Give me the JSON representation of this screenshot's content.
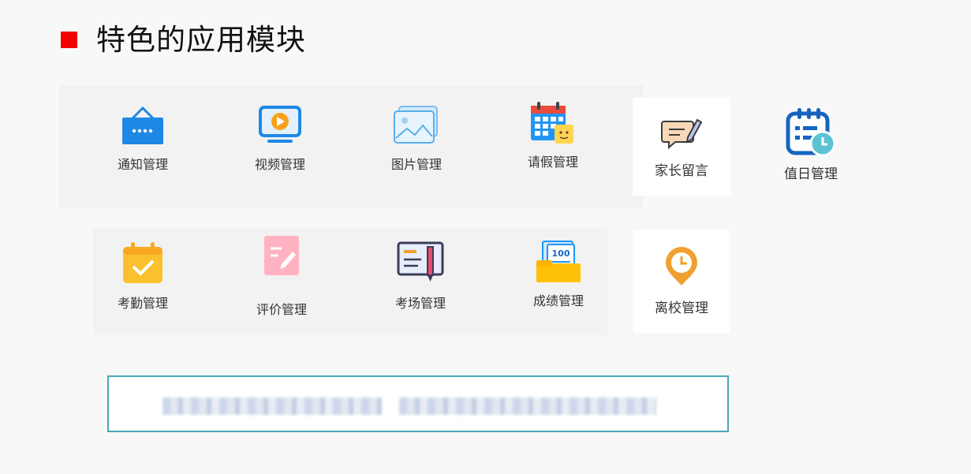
{
  "header": {
    "title": "特色的应用模块"
  },
  "modules_row1": [
    {
      "label": "通知管理",
      "icon": "notification-board-icon"
    },
    {
      "label": "视频管理",
      "icon": "video-monitor-icon"
    },
    {
      "label": "图片管理",
      "icon": "picture-icon"
    },
    {
      "label": "请假管理",
      "icon": "leave-calendar-icon"
    }
  ],
  "modules_row2": [
    {
      "label": "考勤管理",
      "icon": "attendance-calendar-icon"
    },
    {
      "label": "评价管理",
      "icon": "evaluation-edit-icon"
    },
    {
      "label": "考场管理",
      "icon": "exam-room-icon"
    },
    {
      "label": "成绩管理",
      "icon": "score-folder-icon"
    }
  ],
  "side_modules": {
    "parent_message": {
      "label": "家长留言",
      "icon": "message-pen-icon"
    },
    "duty": {
      "label": "值日管理",
      "icon": "duty-calendar-clock-icon"
    },
    "leave_school": {
      "label": "离校管理",
      "icon": "clock-pin-icon"
    }
  },
  "colors": {
    "accent_red": "#f00000",
    "footer_border": "#4aa6b5",
    "icon_blue": "#1e88e5",
    "icon_orange": "#f0a030"
  }
}
